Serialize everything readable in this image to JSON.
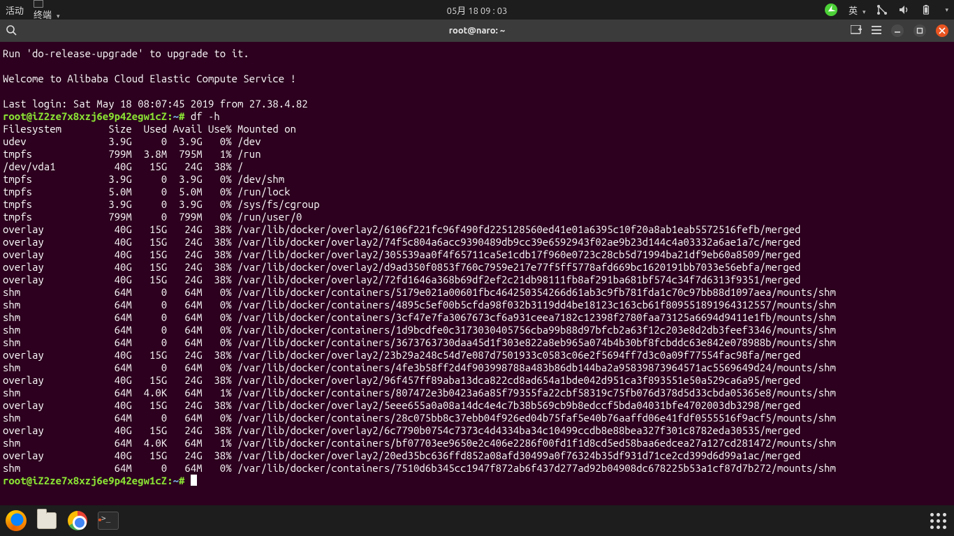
{
  "topbar": {
    "activities": "活动",
    "app_label": "终端",
    "clock": "05月 18 09 : 03",
    "ime": "英"
  },
  "window": {
    "title": "root@naro: ~"
  },
  "terminal": {
    "prompt_user": "root@iZ2ze7x8xzj6e9p42egw1cZ",
    "prompt_path": "~",
    "command": "df -h",
    "banner": [
      "Run 'do-release-upgrade' to upgrade to it.",
      "",
      "Welcome to Alibaba Cloud Elastic Compute Service !",
      "",
      "Last login: Sat May 18 08:07:45 2019 from 27.38.4.82"
    ],
    "header": [
      "Filesystem",
      "Size",
      "Used",
      "Avail",
      "Use%",
      "Mounted on"
    ],
    "rows": [
      [
        "udev",
        "3.9G",
        "0",
        "3.9G",
        "0%",
        "/dev"
      ],
      [
        "tmpfs",
        "799M",
        "3.8M",
        "795M",
        "1%",
        "/run"
      ],
      [
        "/dev/vda1",
        "40G",
        "15G",
        "24G",
        "38%",
        "/"
      ],
      [
        "tmpfs",
        "3.9G",
        "0",
        "3.9G",
        "0%",
        "/dev/shm"
      ],
      [
        "tmpfs",
        "5.0M",
        "0",
        "5.0M",
        "0%",
        "/run/lock"
      ],
      [
        "tmpfs",
        "3.9G",
        "0",
        "3.9G",
        "0%",
        "/sys/fs/cgroup"
      ],
      [
        "tmpfs",
        "799M",
        "0",
        "799M",
        "0%",
        "/run/user/0"
      ],
      [
        "overlay",
        "40G",
        "15G",
        "24G",
        "38%",
        "/var/lib/docker/overlay2/6106f221fc96f490fd225128560ed41e01a6395c10f20a8ab1eab5572516fefb/merged"
      ],
      [
        "overlay",
        "40G",
        "15G",
        "24G",
        "38%",
        "/var/lib/docker/overlay2/74f5c804a6acc9390489db9cc39e6592943f02ae9b23d144c4a03332a6ae1a7c/merged"
      ],
      [
        "overlay",
        "40G",
        "15G",
        "24G",
        "38%",
        "/var/lib/docker/overlay2/305539aa0f4f65711ca5e1cdb17f960e0723c28cb5d71994ba21df9eb60a8509/merged"
      ],
      [
        "overlay",
        "40G",
        "15G",
        "24G",
        "38%",
        "/var/lib/docker/overlay2/d9ad350f0853f760c7959e217e77f5ff5778afd669bc1620191bb7033e56ebfa/merged"
      ],
      [
        "overlay",
        "40G",
        "15G",
        "24G",
        "38%",
        "/var/lib/docker/overlay2/72fd1646a368b69df2ef2c21db98111fb8af291ba681bf574c34f7d6313f9351/merged"
      ],
      [
        "shm",
        "64M",
        "0",
        "64M",
        "0%",
        "/var/lib/docker/containers/5179e021a00601fbc464250354266d61ab3c9fb781fda1c70c97bb88d1097aea/mounts/shm"
      ],
      [
        "shm",
        "64M",
        "0",
        "64M",
        "0%",
        "/var/lib/docker/containers/4895c5ef00b5cfda98f032b3119dd4be18123c163cb61f809551891964312557/mounts/shm"
      ],
      [
        "shm",
        "64M",
        "0",
        "64M",
        "0%",
        "/var/lib/docker/containers/3cf47e7fa3067673cf6a931ceea7182c12398f2780faa73125a6694d9411e1fb/mounts/shm"
      ],
      [
        "shm",
        "64M",
        "0",
        "64M",
        "0%",
        "/var/lib/docker/containers/1d9bcdfe0c3173030405756cba99b88d97bfcb2a63f12c203e8d2db3feef3346/mounts/shm"
      ],
      [
        "shm",
        "64M",
        "0",
        "64M",
        "0%",
        "/var/lib/docker/containers/3673763730daa45d1f303e822a8eb965a074b4b30bf8fcbddc63e842e078988b/mounts/shm"
      ],
      [
        "overlay",
        "40G",
        "15G",
        "24G",
        "38%",
        "/var/lib/docker/overlay2/23b29a248c54d7e087d7501933c0583c06e2f5694ff7d3c0a09f77554fac98fa/merged"
      ],
      [
        "shm",
        "64M",
        "0",
        "64M",
        "0%",
        "/var/lib/docker/containers/4fe3b58ff2d4f903998788a483b86db144ba2a95839873964571ac5569649d24/mounts/shm"
      ],
      [
        "overlay",
        "40G",
        "15G",
        "24G",
        "38%",
        "/var/lib/docker/overlay2/96f457ff89aba13dca822cd8ad654a1bde042d951ca3f893551e50a529ca6a95/merged"
      ],
      [
        "shm",
        "64M",
        "4.0K",
        "64M",
        "1%",
        "/var/lib/docker/containers/807472e3b0423a6a85f79355fa22cbf58319c75fb076d378d5d33cbda05365e8/mounts/shm"
      ],
      [
        "overlay",
        "40G",
        "15G",
        "24G",
        "38%",
        "/var/lib/docker/overlay2/5eee655a0a08a14dc4e4c7b38b569cb9b8edccf5bda04031bfe4702003db3298/merged"
      ],
      [
        "shm",
        "64M",
        "0",
        "64M",
        "0%",
        "/var/lib/docker/containers/28c075bb8c37ebb04f926ed04b75faf5e40b76aaffd06e41fdf0555516f9acf5/mounts/shm"
      ],
      [
        "overlay",
        "40G",
        "15G",
        "24G",
        "38%",
        "/var/lib/docker/overlay2/6c7790b0754c7373c4d4334ba34c10499ccdb8e88bea327f301c8782eda30535/merged"
      ],
      [
        "shm",
        "64M",
        "4.0K",
        "64M",
        "1%",
        "/var/lib/docker/containers/bf07703ee9650e2c406e2286f00fd1f1d8cd5ed58baa6edcea27a127cd281472/mounts/shm"
      ],
      [
        "overlay",
        "40G",
        "15G",
        "24G",
        "38%",
        "/var/lib/docker/overlay2/20ed35bc636ffd852a08afd30499a0f76324b35df931d71ce2cd399d6d99a1ac/merged"
      ],
      [
        "shm",
        "64M",
        "0",
        "64M",
        "0%",
        "/var/lib/docker/containers/7510d6b345cc1947f872ab6f437d277ad92b04908dc678225b53a1cf87d7b272/mounts/shm"
      ]
    ]
  }
}
